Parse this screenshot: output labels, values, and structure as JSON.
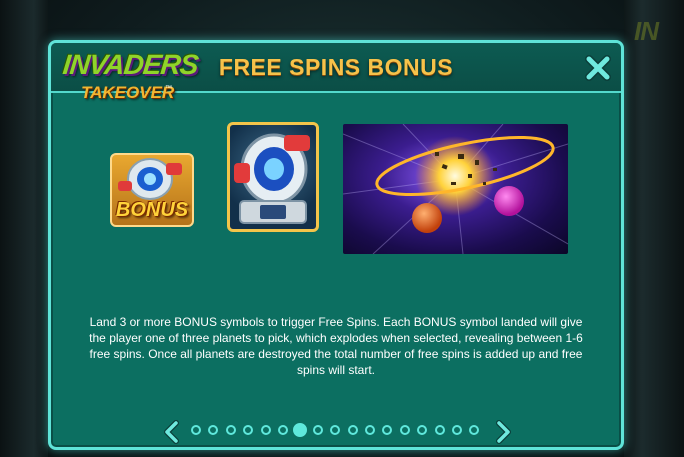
{
  "background": {
    "right_logo_text": "IN"
  },
  "logo": {
    "main": "INVADERS",
    "sub": "TAKEOVER",
    "tm": "™"
  },
  "header": {
    "title": "FREE SPINS BONUS"
  },
  "symbols": {
    "bonus_label": "BONUS"
  },
  "description": "Land 3 or more BONUS symbols to trigger Free Spins. Each BONUS symbol landed will give the player one of three planets to pick, which explodes when selected, revealing between 1-6 free spins. Once all planets are destroyed the total number of free spins is added up and free spins will start.",
  "pagination": {
    "page_count": 17,
    "current_page": 7
  },
  "colors": {
    "panel_bg": "#0c6f61",
    "border": "#5fe3d8",
    "title": "#f6c24a",
    "dot": "#5fe8dc"
  },
  "icons": {
    "close": "close-x-icon",
    "prev": "chevron-left-icon",
    "next": "chevron-right-icon"
  }
}
